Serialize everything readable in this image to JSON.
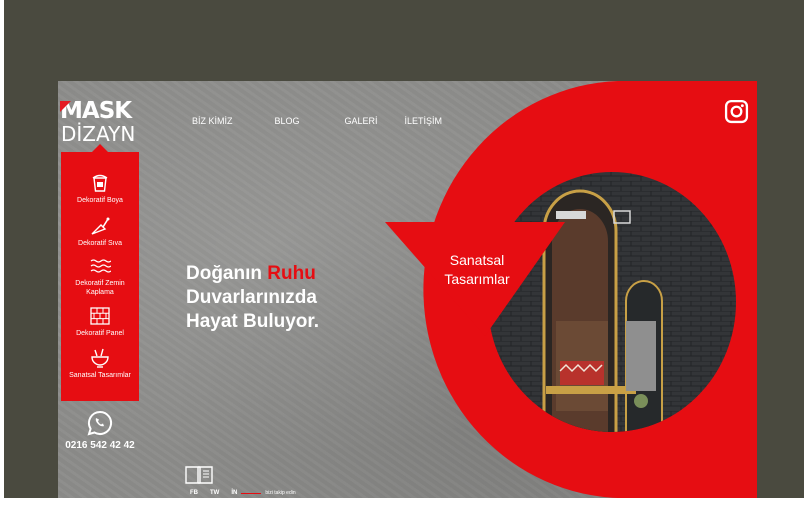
{
  "brand": {
    "name_top": "MASK",
    "name_bottom": "DİZAYN",
    "accent_color": "#e60d12"
  },
  "nav": {
    "items": [
      {
        "label": "BİZ KİMİZ"
      },
      {
        "label": "BLOG"
      },
      {
        "label": "GALERİ"
      },
      {
        "label": "İLETİŞİM"
      }
    ]
  },
  "sidebar": {
    "items": [
      {
        "label": "Dekoratif Boya",
        "icon": "paint-bucket-icon"
      },
      {
        "label": "Dekoratif Sıva",
        "icon": "trowel-icon"
      },
      {
        "label": "Dekoratif Zemin Kaplama",
        "icon": "floor-wave-icon"
      },
      {
        "label": "Dekoratif Panel",
        "icon": "brick-panel-icon"
      },
      {
        "label": "Sanatsal Tasarımlar",
        "icon": "art-bowl-icon"
      }
    ]
  },
  "contact": {
    "phone": "0216 542 42 42",
    "whatsapp_icon": "whatsapp-icon"
  },
  "hero": {
    "line1_pre": "Doğanın ",
    "line1_accent": "Ruhu",
    "line2": "Duvarlarınızda",
    "line3": "Hayat Buluyor."
  },
  "feature": {
    "label_line1": "Sanatsal",
    "label_line2": "Tasarımlar"
  },
  "social": {
    "fb": "FB",
    "tw": "TW",
    "in": "İN",
    "follow_text": "bizi takip edin",
    "instagram_icon": "instagram-icon",
    "catalog_icon": "book-icon"
  }
}
